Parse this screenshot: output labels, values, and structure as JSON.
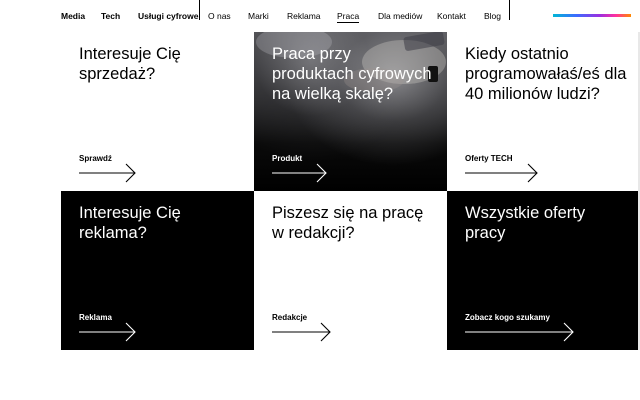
{
  "nav": {
    "primary": [
      {
        "label": "Media"
      },
      {
        "label": "Tech"
      },
      {
        "label": "Usługi cyfrowe"
      }
    ],
    "secondary": [
      {
        "label": "O nas"
      },
      {
        "label": "Marki"
      },
      {
        "label": "Reklama"
      },
      {
        "label": "Praca",
        "active": true
      },
      {
        "label": "Dla mediów"
      },
      {
        "label": "Kontakt"
      },
      {
        "label": "Blog"
      }
    ],
    "accent_gradient": [
      "#00b7d6",
      "#3c6bff",
      "#9b2fe0",
      "#ff2fa0",
      "#ff8a00"
    ]
  },
  "tiles": [
    {
      "heading": "Interesuje Cię sprzedaż?",
      "cta": "Sprawdź",
      "theme": "light"
    },
    {
      "heading": "Praca przy produktach cyfrowych na wielką skalę?",
      "cta": "Produkt",
      "theme": "photo"
    },
    {
      "heading": "Kiedy ostatnio programowałaś/eś dla 40 milionów ludzi?",
      "cta": "Oferty TECH",
      "theme": "light"
    },
    {
      "heading": "Interesuje Cię reklama?",
      "cta": "Reklama",
      "theme": "dark"
    },
    {
      "heading": "Piszesz się na pracę w redakcji?",
      "cta": "Redakcje",
      "theme": "light"
    },
    {
      "heading": "Wszystkie oferty pracy",
      "cta": "Zobacz kogo szukamy",
      "theme": "dark"
    }
  ],
  "icons": {
    "arrow": "arrow-right-icon"
  }
}
